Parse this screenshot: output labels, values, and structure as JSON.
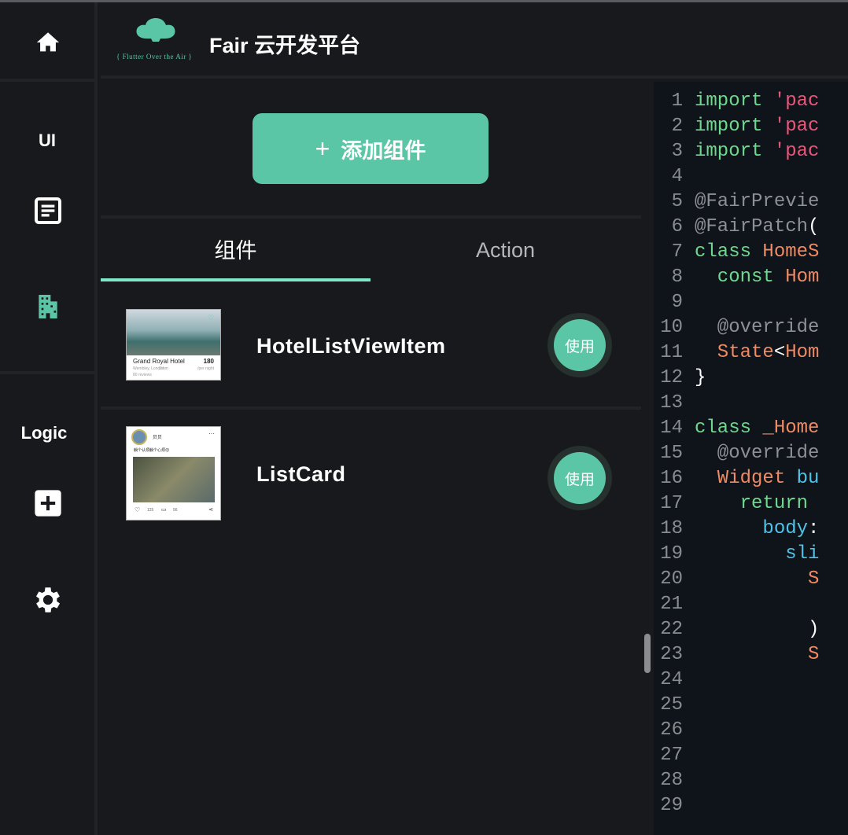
{
  "header": {
    "title": "Fair 云开发平台",
    "logo_text": "{ Flutter Over the Air }"
  },
  "rail": {
    "ui_label": "UI",
    "logic_label": "Logic"
  },
  "panel": {
    "add_button": "添加组件",
    "add_icon": "+",
    "tabs": [
      {
        "label": "组件",
        "active": true
      },
      {
        "label": "Action",
        "active": false
      }
    ]
  },
  "components": [
    {
      "name": "HotelListViewItem",
      "button": "使用",
      "preview": {
        "hotel": "Grand Royal Hotel",
        "price": "180",
        "location": "Wembley, London",
        "distance": "2 km",
        "per": "/per night",
        "reviews": "80 reviews"
      }
    },
    {
      "name": "ListCard",
      "button": "使用",
      "preview": {
        "user": "贝贝",
        "text": "躺个认烦躺个心烦😊",
        "likes": "125",
        "comments": "56"
      }
    }
  ],
  "code": [
    {
      "n": "1",
      "t": [
        [
          "kw",
          "import "
        ],
        [
          "str",
          "'pac"
        ]
      ]
    },
    {
      "n": "2",
      "t": [
        [
          "kw",
          "import "
        ],
        [
          "str",
          "'pac"
        ]
      ]
    },
    {
      "n": "3",
      "t": [
        [
          "kw",
          "import "
        ],
        [
          "str",
          "'pac"
        ]
      ]
    },
    {
      "n": "4",
      "t": []
    },
    {
      "n": "5",
      "t": [
        [
          "ann",
          "@FairPrevie"
        ]
      ]
    },
    {
      "n": "6",
      "t": [
        [
          "ann",
          "@FairPatch"
        ],
        [
          "pl",
          "("
        ]
      ]
    },
    {
      "n": "7",
      "t": [
        [
          "kw",
          "class "
        ],
        [
          "cls",
          "HomeS"
        ]
      ]
    },
    {
      "n": "8",
      "t": [
        [
          "kw",
          "  const "
        ],
        [
          "cls",
          "Hom"
        ]
      ]
    },
    {
      "n": "9",
      "t": []
    },
    {
      "n": "10",
      "t": [
        [
          "ann",
          "  @override"
        ]
      ]
    },
    {
      "n": "11",
      "t": [
        [
          "cls",
          "  State"
        ],
        [
          "pl",
          "<"
        ],
        [
          "cls",
          "Hom"
        ]
      ]
    },
    {
      "n": "12",
      "t": [
        [
          "pl",
          "}"
        ]
      ]
    },
    {
      "n": "13",
      "t": []
    },
    {
      "n": "14",
      "t": [
        [
          "kw",
          "class "
        ],
        [
          "cls",
          "_Home"
        ]
      ]
    },
    {
      "n": "15",
      "t": [
        [
          "ann",
          "  @override"
        ]
      ]
    },
    {
      "n": "16",
      "t": [
        [
          "cls",
          "  Widget "
        ],
        [
          "fn",
          "bu"
        ]
      ]
    },
    {
      "n": "17",
      "t": [
        [
          "kw",
          "    return "
        ]
      ]
    },
    {
      "n": "18",
      "t": [
        [
          "fn",
          "      body"
        ],
        [
          "pl",
          ":"
        ]
      ]
    },
    {
      "n": "19",
      "t": [
        [
          "fn",
          "        sli"
        ]
      ]
    },
    {
      "n": "20",
      "t": [
        [
          "cls",
          "          S"
        ]
      ]
    },
    {
      "n": "21",
      "t": []
    },
    {
      "n": "22",
      "t": [
        [
          "pl",
          "          )"
        ]
      ]
    },
    {
      "n": "23",
      "t": [
        [
          "cls",
          "          S"
        ]
      ]
    },
    {
      "n": "24",
      "t": []
    },
    {
      "n": "25",
      "t": []
    },
    {
      "n": "26",
      "t": []
    },
    {
      "n": "27",
      "t": []
    },
    {
      "n": "28",
      "t": []
    },
    {
      "n": "29",
      "t": []
    }
  ],
  "colors": {
    "accent": "#5bc6a5",
    "tab_indicator": "#7ee8c8",
    "code_bg": "#0f141b"
  }
}
